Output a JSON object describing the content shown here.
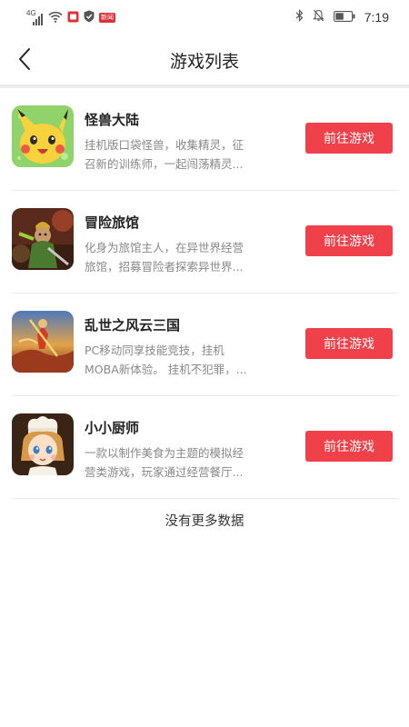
{
  "status_bar": {
    "network_label": "4G",
    "notification_badge": "新闻",
    "time": "7:19",
    "icons": [
      "signal-icon",
      "wifi-icon",
      "notification-app-icon",
      "shield-icon",
      "bluetooth-icon",
      "mute-icon",
      "battery-icon"
    ]
  },
  "header": {
    "title": "游戏列表",
    "back_icon": "chevron-left-icon"
  },
  "games": [
    {
      "name": "怪兽大陆",
      "desc_line1": "挂机版口袋怪兽，收集精灵，征",
      "desc_line2": "召新的训练师，一起闯荡精灵...",
      "button": "前往游戏",
      "icon": "pikachu-game-icon"
    },
    {
      "name": "冒险旅馆",
      "desc_line1": "化身为旅馆主人，在异世界经营",
      "desc_line2": "旅馆，招募冒险者探索异世界...",
      "button": "前往游戏",
      "icon": "adventure-inn-game-icon"
    },
    {
      "name": "乱世之风云三国",
      "desc_line1": "PC移动同享技能竞技，挂机",
      "desc_line2": "MOBA新体验。 挂机不犯罪，...",
      "button": "前往游戏",
      "icon": "three-kingdoms-game-icon"
    },
    {
      "name": "小小厨师",
      "desc_line1": "一款以制作美食为主题的模拟经",
      "desc_line2": "营类游戏，玩家通过经营餐厅...",
      "button": "前往游戏",
      "icon": "little-chef-game-icon"
    }
  ],
  "footer": {
    "no_more_text": "没有更多数据"
  },
  "colors": {
    "accent": "#f0414a",
    "divider": "#e9e9e9",
    "desc_text": "#888888"
  }
}
